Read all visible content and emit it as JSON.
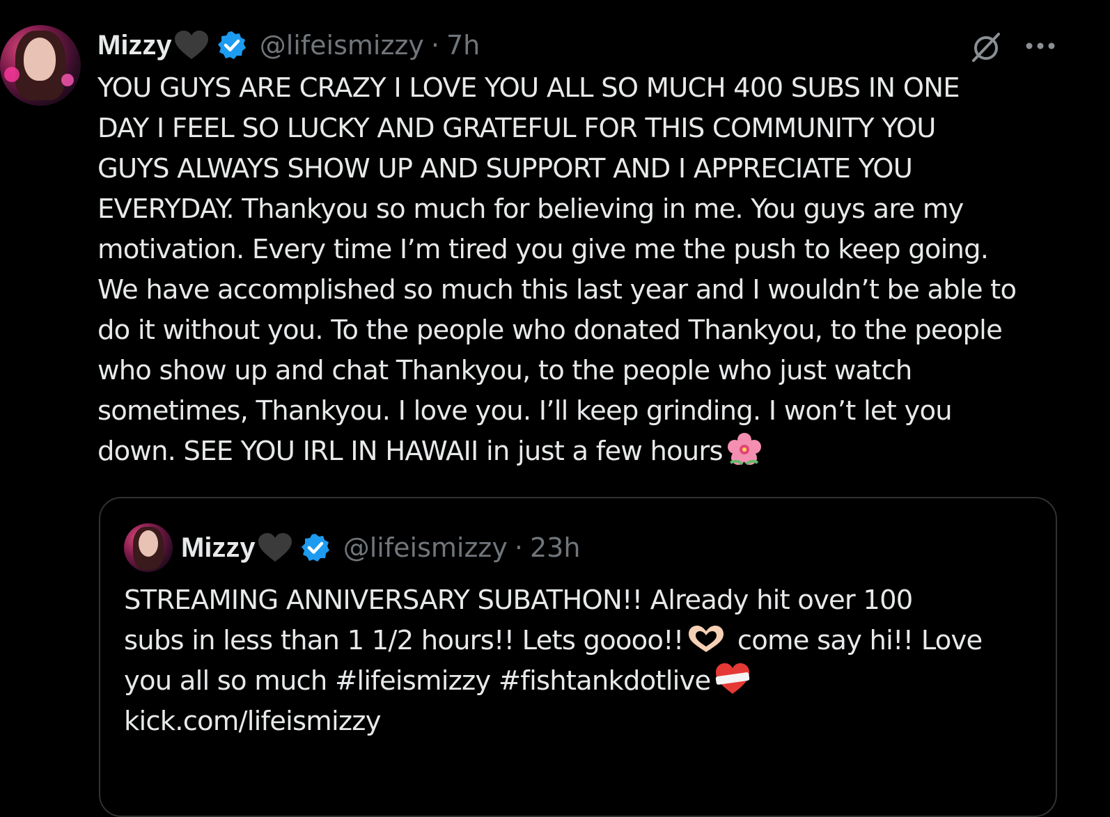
{
  "post": {
    "name": "Mizzy",
    "handle": "@lifeismizzy",
    "separator": "·",
    "time": "7h",
    "lines": [
      "YOU GUYS ARE CRAZY I LOVE YOU ALL SO MUCH 400 SUBS IN ONE",
      "DAY I FEEL SO LUCKY AND GRATEFUL FOR THIS COMMUNITY YOU",
      "GUYS ALWAYS SHOW UP AND SUPPORT AND I APPRECIATE YOU",
      "EVERYDAY. Thankyou so much for believing in me. You guys are my",
      "motivation. Every time I’m tired you give me the push to keep going.",
      "We have accomplished so much this last year and I wouldn’t be able to",
      "do it without you. To the people who donated Thankyou, to the people",
      "who show up and chat Thankyou, to the people who just watch",
      "sometimes, Thankyou. I love you. I’ll keep grinding. I won’t let you",
      "down. SEE YOU IRL IN HAWAII in just a few hours"
    ],
    "trailing_emoji": "hibiscus-emoji",
    "name_icon": "black-heart-emoji",
    "badge_icon": "verified-badge-icon",
    "actions": [
      "grok-icon",
      "more-options-icon"
    ]
  },
  "quote": {
    "name": "Mizzy",
    "handle": "@lifeismizzy",
    "separator": "·",
    "time": "23h",
    "line1": "STREAMING ANNIVERSARY SUBATHON!! Already hit over 100",
    "line2_a": "subs in less than 1 1/2 hours!! Lets goooo!!",
    "line2_b": "come say hi!! Love",
    "line3_a": "you all so much #lifeismizzy #fishtankdotlive",
    "line4": "kick.com/lifeismizzy",
    "emojis": [
      "heart-hands-emoji",
      "mending-heart-emoji"
    ]
  },
  "colors": {
    "background": "#000000",
    "text": "#e7e9ea",
    "secondary": "#71767b",
    "verified": "#1d9bf0",
    "border": "#2f3336"
  }
}
